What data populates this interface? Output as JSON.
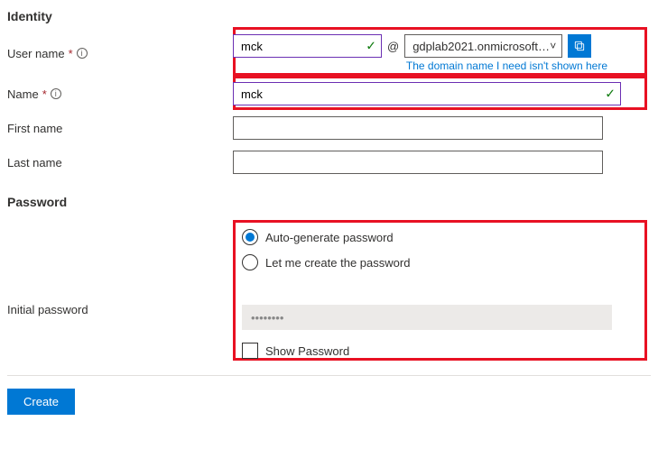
{
  "identity": {
    "section_title": "Identity",
    "username_label": "User name",
    "username_value": "mck",
    "at": "@",
    "domain_value": "gdplab2021.onmicrosoft....",
    "domain_link": "The domain name I need isn't shown here",
    "name_label": "Name",
    "name_value": "mck",
    "first_name_label": "First name",
    "first_name_value": "",
    "last_name_label": "Last name",
    "last_name_value": ""
  },
  "password": {
    "section_title": "Password",
    "option_auto": "Auto-generate password",
    "option_manual": "Let me create the password",
    "initial_label": "Initial password",
    "masked_value": "••••••••",
    "show_label": "Show Password"
  },
  "footer": {
    "create_label": "Create"
  }
}
